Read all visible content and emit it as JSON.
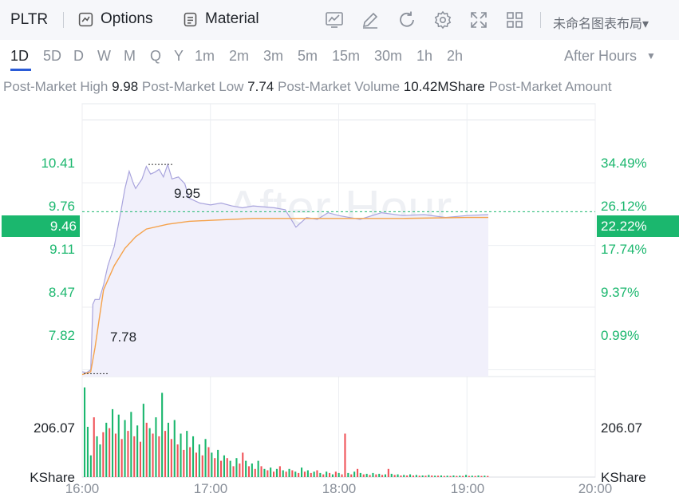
{
  "toolbar": {
    "symbol": "PLTR",
    "options_label": "Options",
    "material_label": "Material",
    "layout_name": "未命名图表布局▾",
    "icons": [
      "chart-icon",
      "pencil-icon",
      "refresh-icon",
      "gear-icon",
      "fullscreen-icon",
      "grid-layout-icon"
    ]
  },
  "timeframes": [
    "1D",
    "5D",
    "D",
    "W",
    "M",
    "Q",
    "Y",
    "1m",
    "2m",
    "3m",
    "5m",
    "15m",
    "30m",
    "1h",
    "2h"
  ],
  "active_timeframe": "1D",
  "session_label": "After Hours",
  "stats": [
    {
      "label": "Post-Market High",
      "value": "9.98"
    },
    {
      "label": "Post-Market Low",
      "value": "7.74"
    },
    {
      "label": "Post-Market Volume",
      "value": "10.42MShare"
    },
    {
      "label": "Post-Market Amount",
      "value": ""
    }
  ],
  "colors": {
    "up": "#1bb76e",
    "down": "#f05359",
    "price_line": "#a9a4dd",
    "avg_line": "#f5a24b",
    "accent": "#2a5bd7"
  },
  "chart_data": {
    "type": "line",
    "watermark": "After Hour",
    "xlim": [
      "16:00",
      "20:00"
    ],
    "x_ticks": [
      "16:00",
      "17:00",
      "18:00",
      "19:00",
      "20:00"
    ],
    "ylim": [
      7.75,
      10.58
    ],
    "y_ticks_left": [
      "10.41",
      "9.76",
      "9.11",
      "8.47",
      "7.82"
    ],
    "y_ticks_right": [
      "34.49%",
      "26.12%",
      "17.74%",
      "9.37%",
      "0.99%"
    ],
    "last_price": "9.46",
    "last_change_pct": "22.22%",
    "annotation_high": "9.95",
    "annotation_low": "7.78",
    "series": [
      {
        "name": "Price",
        "x": [
          "16:00",
          "16:02",
          "16:04",
          "16:05",
          "16:06",
          "16:08",
          "16:10",
          "16:12",
          "16:15",
          "16:18",
          "16:20",
          "16:22",
          "16:24",
          "16:25",
          "16:28",
          "16:30",
          "16:32",
          "16:34",
          "16:36",
          "16:38",
          "16:40",
          "16:42",
          "16:45",
          "16:48",
          "16:50",
          "16:55",
          "17:00",
          "17:05",
          "17:10",
          "17:15",
          "17:20",
          "17:30",
          "17:35",
          "17:40",
          "17:45",
          "17:50",
          "17:55",
          "18:00",
          "18:10",
          "18:20",
          "18:30",
          "18:40",
          "18:50",
          "19:00",
          "19:10"
        ],
        "values": [
          7.8,
          7.79,
          7.82,
          8.5,
          8.55,
          8.55,
          8.7,
          8.9,
          9.1,
          9.45,
          9.7,
          9.88,
          9.75,
          9.7,
          9.8,
          9.93,
          9.85,
          9.87,
          9.9,
          9.82,
          9.95,
          9.8,
          9.82,
          9.75,
          9.6,
          9.55,
          9.53,
          9.55,
          9.52,
          9.5,
          9.52,
          9.5,
          9.48,
          9.3,
          9.4,
          9.38,
          9.45,
          9.42,
          9.38,
          9.45,
          9.42,
          9.43,
          9.4,
          9.42,
          9.43
        ]
      },
      {
        "name": "Average",
        "x": [
          "16:00",
          "16:04",
          "16:06",
          "16:08",
          "16:10",
          "16:15",
          "16:20",
          "16:25",
          "16:30",
          "16:40",
          "16:50",
          "17:00",
          "17:20",
          "17:40",
          "18:00",
          "18:30",
          "19:00",
          "19:10"
        ],
        "values": [
          7.77,
          7.8,
          8.05,
          8.35,
          8.65,
          8.9,
          9.08,
          9.2,
          9.28,
          9.33,
          9.36,
          9.37,
          9.39,
          9.39,
          9.39,
          9.39,
          9.4,
          9.4
        ]
      }
    ],
    "volume": {
      "unit": "KShare",
      "y_tick": "206.07",
      "ylim": [
        0,
        370
      ],
      "bars": [
        [
          330,
          1
        ],
        [
          185,
          1
        ],
        [
          80,
          1
        ],
        [
          220,
          0
        ],
        [
          150,
          1
        ],
        [
          120,
          1
        ],
        [
          165,
          0
        ],
        [
          200,
          1
        ],
        [
          180,
          0
        ],
        [
          250,
          1
        ],
        [
          160,
          0
        ],
        [
          230,
          1
        ],
        [
          140,
          0
        ],
        [
          210,
          1
        ],
        [
          170,
          0
        ],
        [
          240,
          1
        ],
        [
          150,
          0
        ],
        [
          190,
          1
        ],
        [
          130,
          0
        ],
        [
          270,
          1
        ],
        [
          200,
          0
        ],
        [
          180,
          1
        ],
        [
          160,
          0
        ],
        [
          220,
          1
        ],
        [
          150,
          0
        ],
        [
          310,
          1
        ],
        [
          170,
          0
        ],
        [
          200,
          1
        ],
        [
          140,
          0
        ],
        [
          210,
          1
        ],
        [
          120,
          0
        ],
        [
          160,
          1
        ],
        [
          100,
          0
        ],
        [
          170,
          1
        ],
        [
          110,
          0
        ],
        [
          150,
          1
        ],
        [
          90,
          0
        ],
        [
          120,
          1
        ],
        [
          80,
          0
        ],
        [
          140,
          1
        ],
        [
          110,
          0
        ],
        [
          90,
          1
        ],
        [
          70,
          0
        ],
        [
          100,
          1
        ],
        [
          60,
          0
        ],
        [
          80,
          1
        ],
        [
          70,
          0
        ],
        [
          60,
          1
        ],
        [
          40,
          0
        ],
        [
          70,
          1
        ],
        [
          50,
          0
        ],
        [
          90,
          0
        ],
        [
          60,
          1
        ],
        [
          40,
          0
        ],
        [
          50,
          1
        ],
        [
          30,
          0
        ],
        [
          60,
          1
        ],
        [
          40,
          0
        ],
        [
          30,
          1
        ],
        [
          25,
          0
        ],
        [
          35,
          1
        ],
        [
          20,
          0
        ],
        [
          30,
          1
        ],
        [
          40,
          0
        ],
        [
          25,
          1
        ],
        [
          20,
          0
        ],
        [
          30,
          1
        ],
        [
          25,
          0
        ],
        [
          20,
          1
        ],
        [
          15,
          0
        ],
        [
          35,
          1
        ],
        [
          20,
          0
        ],
        [
          25,
          1
        ],
        [
          15,
          0
        ],
        [
          20,
          1
        ],
        [
          25,
          0
        ],
        [
          15,
          1
        ],
        [
          10,
          0
        ],
        [
          20,
          1
        ],
        [
          15,
          0
        ],
        [
          10,
          1
        ],
        [
          20,
          0
        ],
        [
          15,
          1
        ],
        [
          10,
          0
        ],
        [
          160,
          0
        ],
        [
          15,
          1
        ],
        [
          10,
          0
        ],
        [
          20,
          1
        ],
        [
          30,
          0
        ],
        [
          15,
          1
        ],
        [
          10,
          0
        ],
        [
          12,
          1
        ],
        [
          8,
          0
        ],
        [
          15,
          1
        ],
        [
          10,
          0
        ],
        [
          12,
          1
        ],
        [
          8,
          0
        ],
        [
          10,
          1
        ],
        [
          30,
          0
        ],
        [
          12,
          1
        ],
        [
          8,
          0
        ],
        [
          10,
          1
        ],
        [
          6,
          0
        ],
        [
          8,
          1
        ],
        [
          6,
          0
        ],
        [
          10,
          1
        ],
        [
          6,
          0
        ],
        [
          8,
          1
        ],
        [
          5,
          0
        ],
        [
          6,
          1
        ],
        [
          5,
          0
        ],
        [
          8,
          1
        ],
        [
          6,
          0
        ],
        [
          5,
          1
        ],
        [
          5,
          0
        ],
        [
          6,
          1
        ],
        [
          4,
          0
        ],
        [
          5,
          1
        ],
        [
          4,
          0
        ],
        [
          6,
          1
        ],
        [
          4,
          0
        ],
        [
          5,
          1
        ],
        [
          4,
          0
        ],
        [
          8,
          1
        ],
        [
          4,
          0
        ],
        [
          5,
          1
        ],
        [
          4,
          0
        ],
        [
          6,
          1
        ],
        [
          4,
          0
        ],
        [
          5,
          1
        ],
        [
          4,
          0
        ]
      ]
    }
  }
}
